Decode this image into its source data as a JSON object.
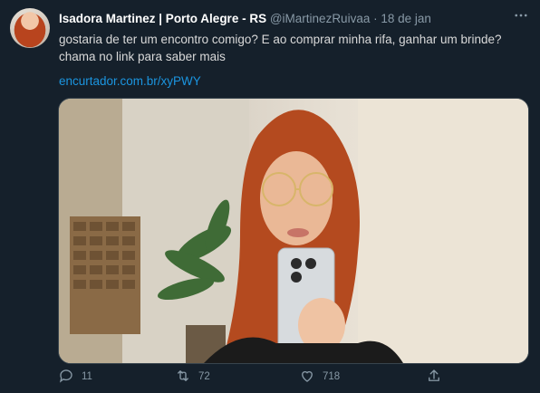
{
  "tweet": {
    "author_name": "Isadora Martinez | Porto Alegre - RS",
    "handle": "@iMartinezRuivaa",
    "separator": "·",
    "date": "18 de jan",
    "text": "gostaria de ter um encontro comigo? E ao comprar minha rifa, ganhar um brinde? chama no link para saber mais",
    "link": "encurtador.com.br/xyPWY"
  },
  "actions": {
    "replies": "11",
    "retweets": "72",
    "likes": "718"
  },
  "colors": {
    "background": "#15202b",
    "text": "#d9d9d9",
    "muted": "#8899a6",
    "link": "#1b95e0"
  }
}
